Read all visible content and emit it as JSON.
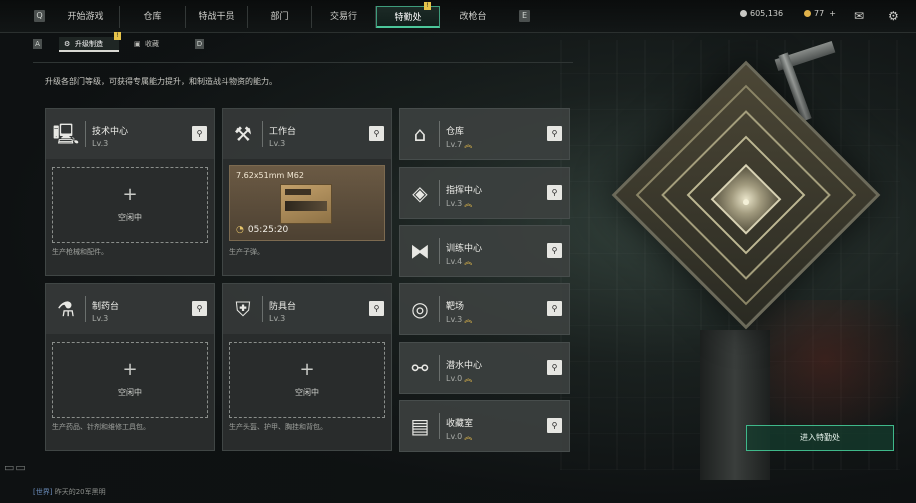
{
  "top_bar": {
    "left_key": "Q",
    "right_key": "E",
    "tabs": [
      {
        "label": "开始游戏"
      },
      {
        "label": "仓库"
      },
      {
        "label": "特战干员"
      },
      {
        "label": "部门"
      },
      {
        "label": "交易行"
      },
      {
        "label": "特勤处",
        "active": true,
        "badge": "!"
      },
      {
        "label": "改枪台"
      }
    ],
    "currency_1": "605,136",
    "currency_2": "77",
    "currency_2_plus": "+",
    "colors": {
      "currency_1": "#c8c8c4",
      "currency_2": "#e0b24a",
      "accent": "#4cc79a"
    }
  },
  "sub_tabs": {
    "left_key": "A",
    "right_key": "D",
    "items": [
      {
        "label": "升级制造",
        "icon": "gear-icon",
        "active": true,
        "badge": "!"
      },
      {
        "label": "收藏",
        "icon": "collection-icon"
      }
    ]
  },
  "description": "升级各部门等级，可获得专属能力提升，和制造战斗物资的能力。",
  "workstations": [
    {
      "name": "技术中心",
      "level": "Lv.3",
      "icon": "computer-icon",
      "slot_state": "空闲中",
      "footer": "生产枪械和配件。"
    },
    {
      "name": "工作台",
      "level": "Lv.3",
      "icon": "tools-icon",
      "production_item": "7.62x51mm M62",
      "production_timer": "05:25:20",
      "footer": "生产子弹。"
    },
    {
      "name": "制药台",
      "level": "Lv.3",
      "icon": "flask-icon",
      "slot_state": "空闲中",
      "footer": "生产药品、针剂和维修工具包。"
    },
    {
      "name": "防具台",
      "level": "Lv.3",
      "icon": "armor-icon",
      "slot_state": "空闲中",
      "footer": "生产头盔、护甲、胸挂和背包。"
    }
  ],
  "facilities": [
    {
      "name": "仓库",
      "level": "Lv.7",
      "icon": "vault-icon"
    },
    {
      "name": "指挥中心",
      "level": "Lv.3",
      "icon": "command-icon"
    },
    {
      "name": "训练中心",
      "level": "Lv.4",
      "icon": "dumbbell-icon"
    },
    {
      "name": "靶场",
      "level": "Lv.3",
      "icon": "target-icon"
    },
    {
      "name": "潜水中心",
      "level": "Lv.0",
      "icon": "diving-icon"
    },
    {
      "name": "收藏室",
      "level": "Lv.0",
      "icon": "display-case-icon"
    }
  ],
  "enter_button": "进入特勤处",
  "chat": {
    "channel": "[世界]",
    "message": "昨天的20军黑明"
  }
}
